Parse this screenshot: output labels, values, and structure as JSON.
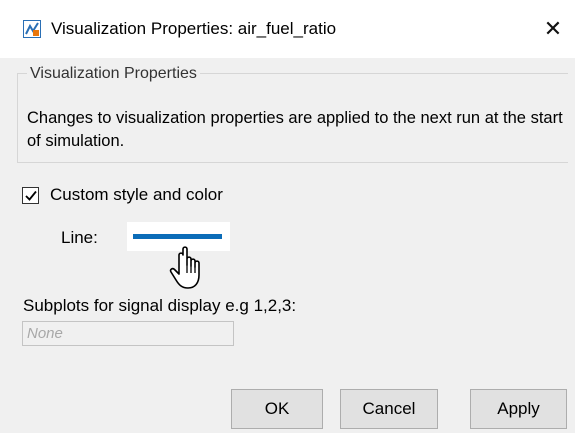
{
  "window": {
    "title": "Visualization Properties: air_fuel_ratio",
    "close_glyph": "✕",
    "icon": "simulink-model-icon"
  },
  "group": {
    "legend": "Visualization Properties",
    "description": "Changes to visualization properties are applied to the next run at the start of simulation."
  },
  "custom_style": {
    "checked": true,
    "label": "Custom style and color"
  },
  "line": {
    "label": "Line:",
    "color": "#0b6cb8"
  },
  "subplots": {
    "label": "Subplots for signal display e.g 1,2,3:",
    "value": "",
    "placeholder": "None"
  },
  "buttons": {
    "ok": "OK",
    "cancel": "Cancel",
    "apply": "Apply"
  },
  "cursor": "hand-pointer-icon"
}
